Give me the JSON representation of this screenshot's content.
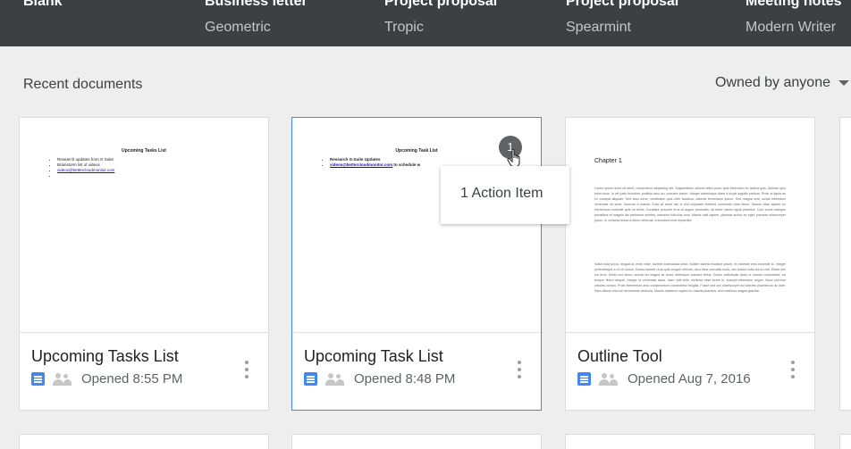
{
  "templates": [
    {
      "name": "Blank",
      "theme": ""
    },
    {
      "name": "Business letter",
      "theme": "Geometric"
    },
    {
      "name": "Project proposal",
      "theme": "Tropic"
    },
    {
      "name": "Project proposal",
      "theme": "Spearmint"
    },
    {
      "name": "Meeting notes",
      "theme": "Modern Writer"
    }
  ],
  "section": {
    "title": "Recent documents",
    "owner_filter": "Owned by anyone"
  },
  "documents": [
    {
      "title": "Upcoming Tasks List",
      "opened": "Opened  8:55 PM",
      "thumb_title": "Upcoming Tasks List",
      "thumb_bullets": [
        "Research updates from G Suite",
        "Brainstorm list of videos",
        "videos@bettercloudmonitor.com",
        ""
      ]
    },
    {
      "title": "Upcoming Task List",
      "opened": "Opened  8:48 PM",
      "thumb_title": "Upcoming Task List",
      "thumb_bullets": [
        "Research G-Suite Updates",
        "videos@bettercloudmonitor.com",
        "to schedule w"
      ],
      "badge": "1",
      "tooltip": "1 Action Item"
    },
    {
      "title": "Outline Tool",
      "opened": "Opened  Aug 7, 2016",
      "thumb_chapter": "Chapter 1",
      "thumb_para1": "Lorem ipsum dolor sit amet, consectetur adipiscing elit. Suspendisse ultrices tellus justo, quis bibendum ex lacinia quis. Aenean quis enim risus. In vel justo tincidunt, porttitor arcu eu, posuere ipsum. Integer scelerisque diam a turpis sagittis pretium. Proin at ligula ac ex volutpat aliquam. Sed arcu tortor, vestibulum quis nibh faucibus, lobortis fermentum ipsum. Sed magna erat, luctus bibendum venenatis sit amet, rhoncus a massa. Cras sit amet nisi in nisl vulputate eleifend commodo vitae libero. Mauris vitae sapien eu elementum molestie quis eu tellus. Curabitur posuere eros at augue venenatis, sit amet rutrum ligula pharetra. Cum sociis natoque penatibus et magnis dis parturient montes, nascetur ridiculus mus. Mauris velit sapien, placerat auctor ex eget, posuere ullamcorper purus. In vehicula tellus ut libero vehicula, a tincidunt enim imperdiet.",
      "thumb_para2": "Nulla nulla purus, feugiat ac enim vitae, laoreet malesuada tortor. Nullam lacinia tincidunt ipsum, et molestie eros molestie id. Integer pellentesque a mi ut rutrum. Donec laoreet urna quis congue ultrices, arcu risus convallis nulla, nec auctor nulla dui eu nisi. Etiam nec dui eros. Morbi orci lacus, lacinia vel magna sit amet, bibendum posuere tellus. Donec sollicitudin dolor ut mauris consectetur, eu tempor libero aliquet. Integer id venenatis lacus. Nam velit felis, eleifend vitae lorem in, suscipit bibendum augue. Nunc pulvinar ultricies cursus. Proin elementum arcu condimentum consectetur fringilla. Fusce sed orci ullamcorper dui lobortis pharetra ac ac ante. Nam dictum nisl non fermentum vehicula. Mauris maximus sapien eu mauris pharetra, sed maximus magna gravida."
    }
  ],
  "colors": {
    "template_bar": "#3c4043",
    "page_bg": "#eeeeee",
    "selected_border": "#4285f4",
    "docs_blue": "#4285f4"
  }
}
